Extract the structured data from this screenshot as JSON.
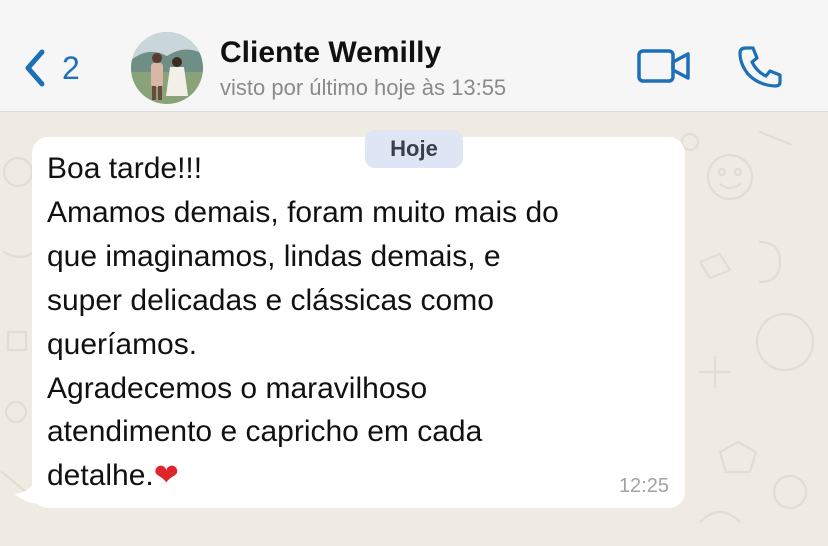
{
  "header": {
    "back_count": "2",
    "contact_name": "Cliente Wemilly",
    "contact_status": "visto por último hoje às 13:55"
  },
  "chat": {
    "date_label": "Hoje",
    "message": {
      "lines": [
        "Boa tarde!!!",
        "Amamos demais, foram muito mais do",
        "que imaginamos, lindas demais, e",
        "super delicadas e clássicas como",
        "queríamos.",
        "Agradecemos o maravilhoso",
        "atendimento e capricho em cada",
        "detalhe."
      ],
      "emoji": "❤",
      "time": "12:25"
    }
  },
  "colors": {
    "accent": "#1d6fb8",
    "chat_background": "#efeae2",
    "bubble": "#ffffff",
    "date_pill": "#dfe5f5"
  },
  "icons": [
    "chevron-left-icon",
    "video-camera-icon",
    "phone-icon"
  ]
}
